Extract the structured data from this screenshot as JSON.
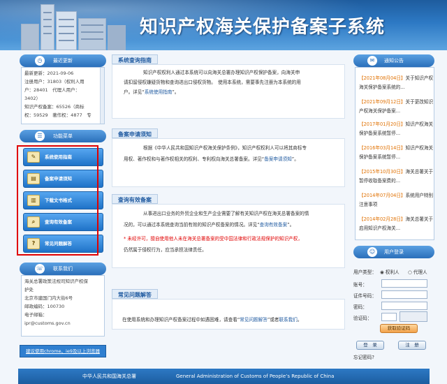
{
  "header": {
    "title": "知识产权海关保护备案子系统"
  },
  "left": {
    "update_header": "最近更新",
    "update_lines": [
      "最新更新：2021-09-06",
      "注册用户：31803（权利人用",
      "户：28401　代理人用户：",
      "3402）",
      "知识产权备案：65526（商标",
      "权：59529　著作权：4877　专"
    ],
    "menu_header": "功能菜单",
    "menu": [
      "系统使用指南",
      "备案申请须知",
      "下载文书格式",
      "查询有效备案",
      "常见问题解答"
    ],
    "contact_header": "联系我们",
    "contact_lines": [
      "海关总署政策法规司知识产权保",
      "护处",
      "北京市建国门内大街6号",
      "邮政编码：100730",
      "电子邮箱：",
      "ipr@customs.gov.cn"
    ],
    "browser_note": "建议使用chrome、ie9及以上浏览器"
  },
  "main": {
    "s1": {
      "title": "系统查询指南",
      "l1": "知识产权权利人通过本系统可以向海关总署办理知识产权保护备案，向海关申",
      "l2": "请扣留侵权嫌疑货物和查询进出口侵权货物。　使用本系统，需要事先注册为本系统的用",
      "l3a": "户。详见“",
      "l3link": "系统使用指南",
      "l3b": "”。"
    },
    "s2": {
      "title": "备案申请须知",
      "l1": "根据《中华人民共和国知识产权海关保护条例》，知识产权权利人可以将其商标专",
      "l2a": "用权、著作权和与著作权相关的权利、专利权向海关总署备案。详见“",
      "l2link": "备案申请须知",
      "l2b": "”。"
    },
    "s3": {
      "title": "查询有效备案",
      "l1": "从事进出口业务的外贸企业和生产企业需要了解有关知识产权在海关总署备案的情",
      "l2a": "况的，可以通过本系统查询当前有效的知识产权备案的情况。详见“",
      "l2link": "查询有效备案",
      "l2b": "”。",
      "warn": "* 未经许可，擅自使用他人未在海关总署备案的受中国法律和行政法规保护的知识产权，",
      "l4": "仍然属于侵权行为，应当承担法律责任。"
    },
    "s4": {
      "title": "常见问题解答",
      "l1a": "在使用系统和办理知识产权备案过程中如遇困难，请查看“",
      "l1link": "常见问题解答",
      "l1b": "”或者",
      "l1link2": "联系我们",
      "l1c": "。"
    }
  },
  "right": {
    "notice_header": "通知公告",
    "notices": [
      {
        "date": "【2021年08月04日】",
        "text": "关于知识产权海关保护备案系统的..."
      },
      {
        "date": "【2021年09月12日】",
        "text": "关于更改知识产权海关保护备案..."
      },
      {
        "date": "【2017年01月20日】",
        "text": "知识产权海关保护备案系统暂停..."
      },
      {
        "date": "【2016年03月14日】",
        "text": "知识产权海关保护备案系统暂停..."
      },
      {
        "date": "【2015年10月30日】",
        "text": "海关总署关于暂停收取备案费的..."
      },
      {
        "date": "【2014年07月04日】",
        "text": "系统用户特别注意事项"
      },
      {
        "date": "【2014年02月28日】",
        "text": "海关总署关于启用知识产权海关..."
      }
    ],
    "login_header": "用户登录",
    "user_type_label": "用户类型：",
    "opt1": "权利人",
    "opt2": "代理人",
    "account": "账号：",
    "cert": "证件号码：",
    "password": "密码：",
    "captcha": "验证码：",
    "get_captcha": "获取验证码",
    "login": "登　录",
    "register": "注　册",
    "forgot": "忘记密码?"
  },
  "footer": {
    "cn": "中华人民共和国海关总署",
    "en": "General Administration of Customs of People’s Republic of China"
  }
}
